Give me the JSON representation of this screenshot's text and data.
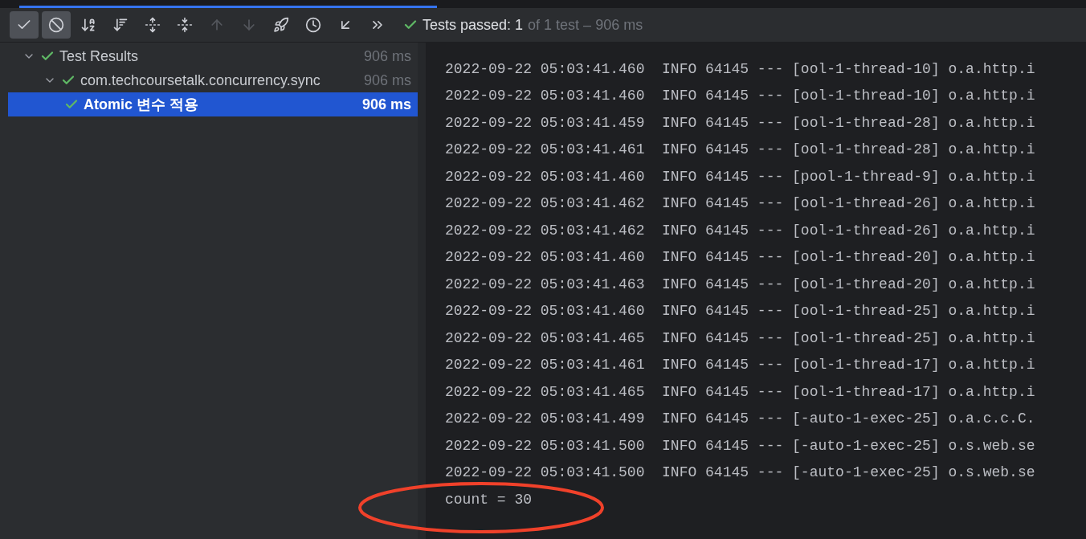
{
  "progress": {
    "level": 1
  },
  "toolbar": {
    "buttons": [
      {
        "kind": "check",
        "selected": true,
        "disabled": false
      },
      {
        "kind": "cancel",
        "selected": true,
        "disabled": false
      },
      {
        "kind": "sort-alpha",
        "selected": false,
        "disabled": false
      },
      {
        "kind": "sort-duration",
        "selected": false,
        "disabled": false
      },
      {
        "kind": "expand",
        "selected": false,
        "disabled": false
      },
      {
        "kind": "collapse",
        "selected": false,
        "disabled": false
      },
      {
        "kind": "up",
        "selected": false,
        "disabled": true
      },
      {
        "kind": "down",
        "selected": false,
        "disabled": true
      },
      {
        "kind": "import",
        "selected": false,
        "disabled": false
      },
      {
        "kind": "history",
        "selected": false,
        "disabled": false
      },
      {
        "kind": "export",
        "selected": false,
        "disabled": false
      },
      {
        "kind": "more",
        "selected": false,
        "disabled": false
      }
    ]
  },
  "status": {
    "passed": "Tests passed: 1",
    "detail": "of 1 test – 906 ms"
  },
  "tree": [
    {
      "label": "Test Results",
      "duration": "906 ms",
      "expanded": true,
      "selected": false,
      "children": [
        {
          "label": "com.techcoursetalk.concurrency.sync",
          "duration": "906 ms",
          "expanded": true,
          "selected": false,
          "children": [
            {
              "label": "Atomic 변수 적용",
              "duration": "906 ms",
              "selected": true
            }
          ]
        }
      ]
    }
  ],
  "console": {
    "lines": [
      "2022-09-22 05:03:41.460  INFO 64145 --- [ool-1-thread-10] o.a.http.i",
      "2022-09-22 05:03:41.460  INFO 64145 --- [ool-1-thread-10] o.a.http.i",
      "2022-09-22 05:03:41.459  INFO 64145 --- [ool-1-thread-28] o.a.http.i",
      "2022-09-22 05:03:41.461  INFO 64145 --- [ool-1-thread-28] o.a.http.i",
      "2022-09-22 05:03:41.460  INFO 64145 --- [pool-1-thread-9] o.a.http.i",
      "2022-09-22 05:03:41.462  INFO 64145 --- [ool-1-thread-26] o.a.http.i",
      "2022-09-22 05:03:41.462  INFO 64145 --- [ool-1-thread-26] o.a.http.i",
      "2022-09-22 05:03:41.460  INFO 64145 --- [ool-1-thread-20] o.a.http.i",
      "2022-09-22 05:03:41.463  INFO 64145 --- [ool-1-thread-20] o.a.http.i",
      "2022-09-22 05:03:41.460  INFO 64145 --- [ool-1-thread-25] o.a.http.i",
      "2022-09-22 05:03:41.465  INFO 64145 --- [ool-1-thread-25] o.a.http.i",
      "2022-09-22 05:03:41.461  INFO 64145 --- [ool-1-thread-17] o.a.http.i",
      "2022-09-22 05:03:41.465  INFO 64145 --- [ool-1-thread-17] o.a.http.i",
      "2022-09-22 05:03:41.499  INFO 64145 --- [-auto-1-exec-25] o.a.c.c.C.",
      "2022-09-22 05:03:41.500  INFO 64145 --- [-auto-1-exec-25] o.s.web.se",
      "2022-09-22 05:03:41.500  INFO 64145 --- [-auto-1-exec-25] o.s.web.se",
      "count = 30"
    ]
  }
}
